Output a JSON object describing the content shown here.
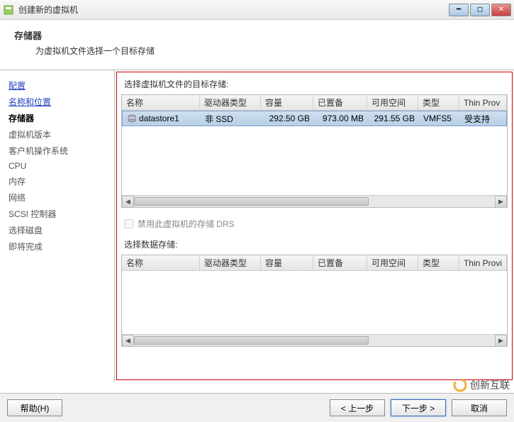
{
  "window": {
    "title": "创建新的虚拟机"
  },
  "header": {
    "title": "存储器",
    "subtitle": "为虚拟机文件选择一个目标存储"
  },
  "sidebar": {
    "items": [
      {
        "label": "配置",
        "state": "link"
      },
      {
        "label": "名称和位置",
        "state": "link"
      },
      {
        "label": "存储器",
        "state": "active"
      },
      {
        "label": "虚拟机版本",
        "state": "normal"
      },
      {
        "label": "客户机操作系统",
        "state": "normal"
      },
      {
        "label": "CPU",
        "state": "normal"
      },
      {
        "label": "内存",
        "state": "normal"
      },
      {
        "label": "网络",
        "state": "normal"
      },
      {
        "label": "SCSI 控制器",
        "state": "normal"
      },
      {
        "label": "选择磁盘",
        "state": "normal"
      },
      {
        "label": "即将完成",
        "state": "normal"
      }
    ]
  },
  "main": {
    "section1_label": "选择虚拟机文件的目标存储:",
    "columns": {
      "name": "名称",
      "drive_type": "驱动器类型",
      "capacity": "容量",
      "provisioned": "已置备",
      "free": "可用空间",
      "type": "类型",
      "thin": "Thin Prov"
    },
    "rows": [
      {
        "name": "datastore1",
        "drive_type": "非 SSD",
        "capacity": "292.50 GB",
        "provisioned": "973.00 MB",
        "free": "291.55 GB",
        "type": "VMFS5",
        "thin": "受支持"
      }
    ],
    "drs_checkbox_label": "禁用此虚拟机的存储 DRS",
    "section2_label": "选择数据存储:",
    "columns2": {
      "name": "名称",
      "drive_type": "驱动器类型",
      "capacity": "容量",
      "provisioned": "已置备",
      "free": "可用空间",
      "type": "类型",
      "thin": "Thin Provi"
    }
  },
  "footer": {
    "help": "帮助(H)",
    "back": "< 上一步",
    "next": "下一步 >",
    "cancel": "取消"
  },
  "watermark": "创新互联"
}
